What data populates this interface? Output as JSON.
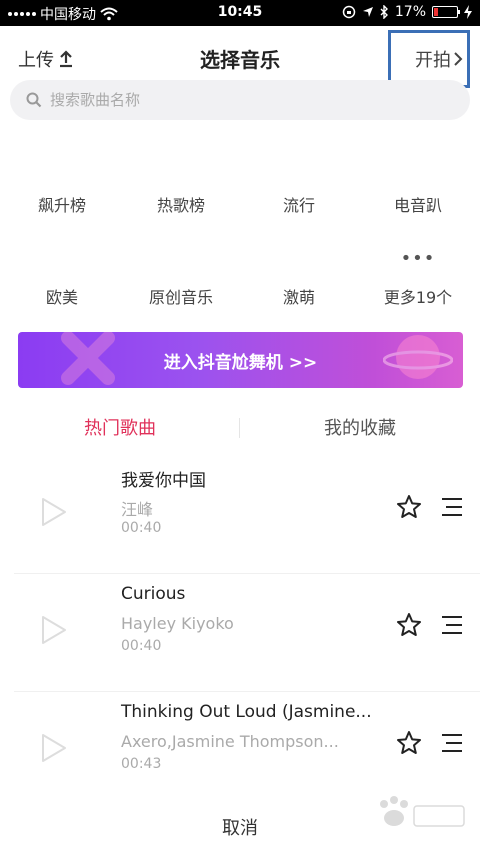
{
  "status_bar": {
    "carrier": "中国移动",
    "time": "10:45",
    "battery": "17%",
    "battery_level": 0.17,
    "icons": [
      "signal-icon",
      "wifi-icon",
      "rotation-lock-icon",
      "location-icon",
      "bluetooth-icon",
      "battery-icon",
      "charging-icon"
    ]
  },
  "nav": {
    "upload_label": "上传",
    "title": "选择音乐",
    "start_label": "开拍"
  },
  "search": {
    "placeholder": "搜索歌曲名称"
  },
  "categories": [
    {
      "label": "飙升榜"
    },
    {
      "label": "热歌榜"
    },
    {
      "label": "流行"
    },
    {
      "label": "电音趴"
    },
    {
      "label": "欧美"
    },
    {
      "label": "原创音乐"
    },
    {
      "label": "激萌"
    },
    {
      "label": "更多19个"
    }
  ],
  "banner": {
    "label": "进入抖音尬舞机 >>"
  },
  "tabs": {
    "hot": "热门歌曲",
    "favorites": "我的收藏"
  },
  "songs": [
    {
      "title": "我爱你中国",
      "artist": "汪峰",
      "duration": "00:40"
    },
    {
      "title": "Curious",
      "artist": "Hayley Kiyoko",
      "duration": "00:40"
    },
    {
      "title": "Thinking Out Loud (Jasmine...",
      "artist": "Axero,Jasmine Thompson...",
      "duration": "00:43"
    }
  ],
  "footer": {
    "cancel_label": "取消"
  },
  "colors": {
    "accent": "#e0315a",
    "banner_start": "#8b3cf2",
    "banner_end": "#d85ed3",
    "highlight_box": "#3b6fb6"
  }
}
